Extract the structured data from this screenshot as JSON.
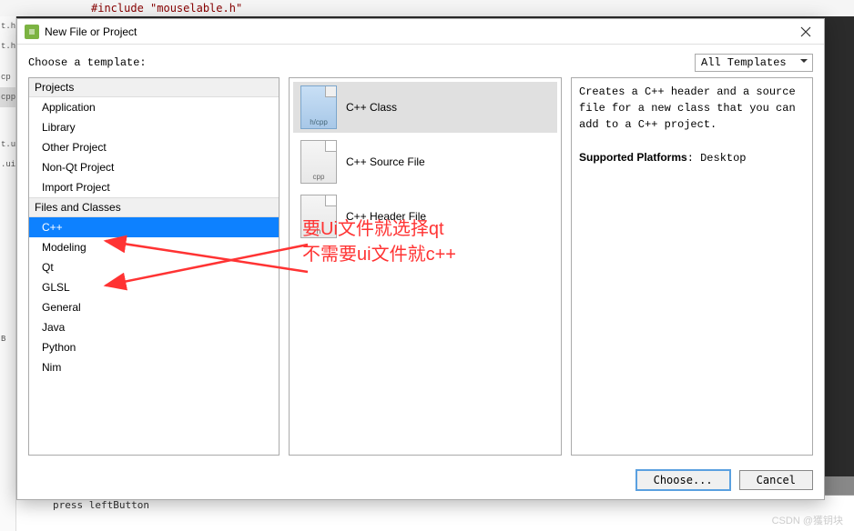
{
  "editor": {
    "top_line": "#include \"mouselable.h\"",
    "bottom_line1": "press leftButton",
    "side_fragments": [
      "t.h",
      "t.h",
      "cp",
      "cpp",
      "t.ui",
      ".ui",
      "B"
    ]
  },
  "dialog": {
    "title": "New File or Project",
    "prompt": "Choose a template:",
    "filter_label": "All Templates",
    "categories": [
      {
        "header": "Projects"
      },
      {
        "item": "Application"
      },
      {
        "item": "Library"
      },
      {
        "item": "Other Project"
      },
      {
        "item": "Non-Qt Project"
      },
      {
        "item": "Import Project"
      },
      {
        "header": "Files and Classes"
      },
      {
        "item": "C++",
        "selected": true
      },
      {
        "item": "Modeling"
      },
      {
        "item": "Qt"
      },
      {
        "item": "GLSL"
      },
      {
        "item": "General"
      },
      {
        "item": "Java"
      },
      {
        "item": "Python"
      },
      {
        "item": "Nim"
      }
    ],
    "file_types": [
      {
        "ext": "h/cpp",
        "label": "C++ Class",
        "blue": true,
        "selected": true
      },
      {
        "ext": "cpp",
        "label": "C++ Source File"
      },
      {
        "ext": "h",
        "label": "C++ Header File"
      }
    ],
    "description_line1": "Creates a C++ header and a source file for a new class that you can add to a C++ project.",
    "description_platforms_label": "Supported Platforms",
    "description_platforms_value": ": Desktop",
    "buttons": {
      "choose": "Choose...",
      "cancel": "Cancel"
    }
  },
  "annotation": {
    "line1": "要Ui文件就选择qt",
    "line2": "不需要ui文件就c++"
  },
  "watermark": "CSDN @獲钥块"
}
